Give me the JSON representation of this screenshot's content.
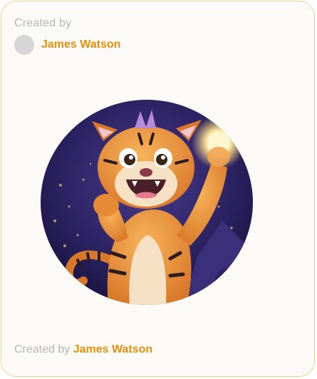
{
  "card": {
    "created_by_label": "Created by",
    "author": {
      "name": "James Watson"
    },
    "artwork": {
      "subject": "cartoon tiger holding a glowing orb"
    },
    "footer": {
      "label": "Created by",
      "author_name": "James Watson"
    }
  },
  "colors": {
    "accent": "#e58f0d",
    "border": "#f0cf93",
    "muted_text": "#b9b6b0",
    "card_bg": "#fcfaf6"
  }
}
